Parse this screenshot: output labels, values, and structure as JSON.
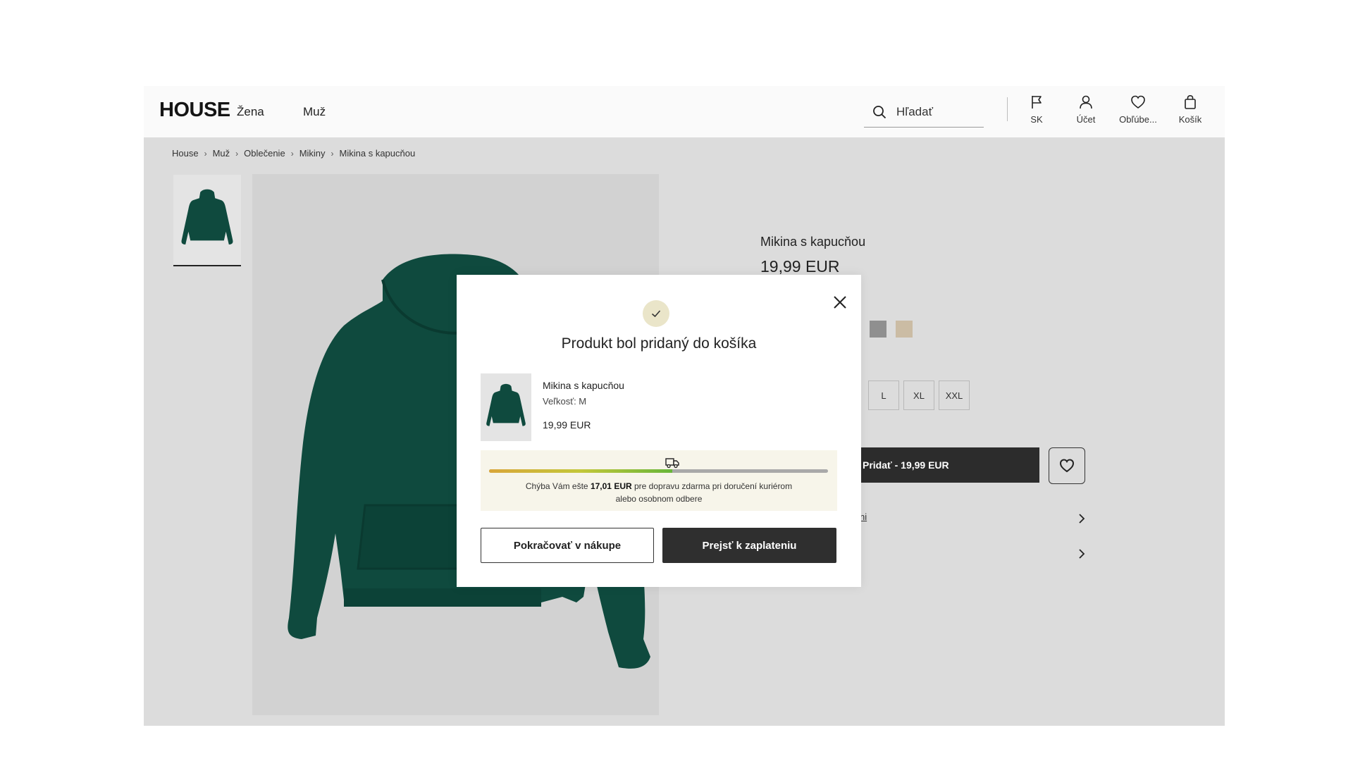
{
  "header": {
    "logo": "HOUSE",
    "nav": [
      "Žena",
      "Muž"
    ],
    "search_placeholder": "Hľadať",
    "items": [
      {
        "label": "SK",
        "icon": "flag-icon"
      },
      {
        "label": "Účet",
        "icon": "user-icon"
      },
      {
        "label": "Obľúbe...",
        "icon": "heart-icon"
      },
      {
        "label": "Košík",
        "icon": "bag-icon"
      }
    ]
  },
  "breadcrumb": [
    "House",
    "Muž",
    "Oblečenie",
    "Mikiny",
    "Mikina s kapucňou"
  ],
  "product": {
    "title": "Mikina s kapucňou",
    "price": "19,99 EUR",
    "color_swatches": [
      "#8f8f8f",
      "#cbbca4"
    ],
    "sizes": [
      "L",
      "XL",
      "XXL"
    ],
    "add_button": "Pridať - 19,99 EUR",
    "link_fragment": "ni",
    "garment_color": "#0f4a3e"
  },
  "modal": {
    "title": "Produkt bol pridaný do košíka",
    "item": {
      "name": "Mikina s kapucňou",
      "size": "Veľkosť: M",
      "price": "19,99 EUR"
    },
    "shipping": {
      "progress_fraction": 0.54,
      "text_before": "Chýba Vám ešte",
      "amount": "17,01 EUR",
      "text_after": "pre dopravu zdarma pri doručení kuriérom",
      "text_line2": "alebo osobnom odbere"
    },
    "continue_label": "Pokračovať v nákupe",
    "checkout_label": "Prejsť k zaplateniu",
    "accent_color": "#eae5c9"
  }
}
